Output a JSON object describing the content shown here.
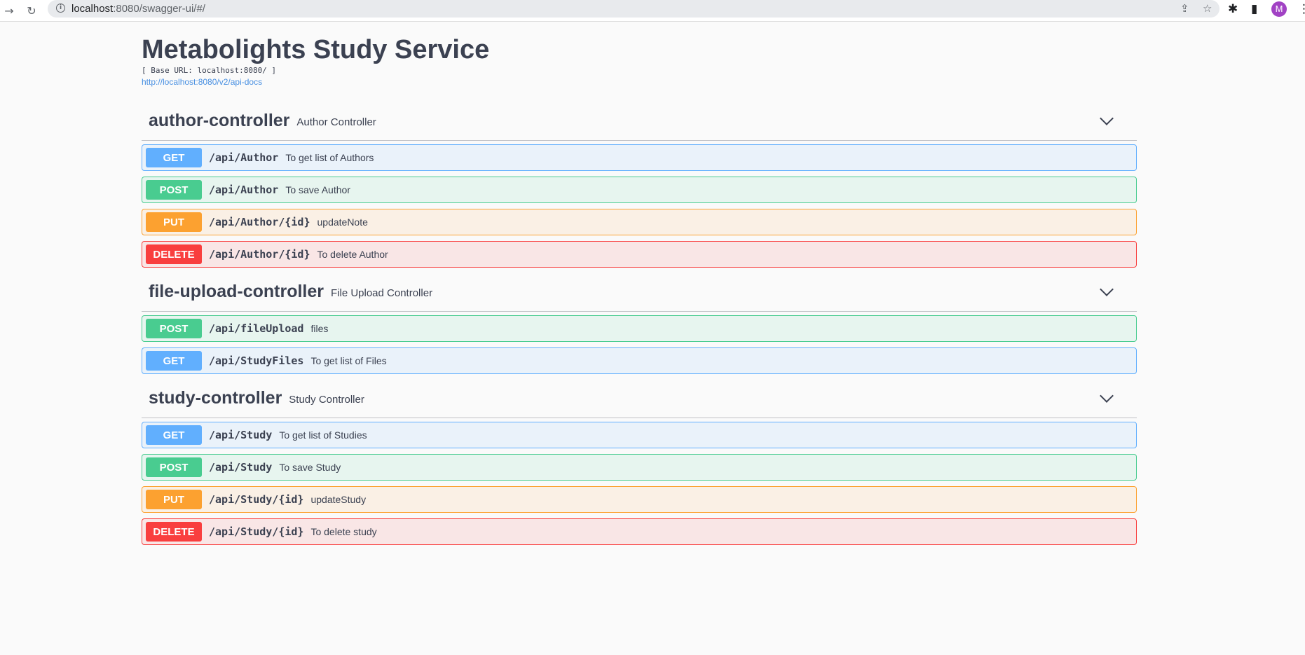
{
  "browser": {
    "url_host": "localhost",
    "url_rest": ":8080/swagger-ui/#/",
    "avatar_letter": "M"
  },
  "info": {
    "title": "Metabolights Study Service",
    "base_url": "[ Base URL: localhost:8080/ ]",
    "spec_link": "http://localhost:8080/v2/api-docs"
  },
  "tags": [
    {
      "name": "author-controller",
      "description": "Author Controller",
      "ops": [
        {
          "method": "GET",
          "path": "/api/Author",
          "summary": "To get list of Authors"
        },
        {
          "method": "POST",
          "path": "/api/Author",
          "summary": "To save Author"
        },
        {
          "method": "PUT",
          "path": "/api/Author/{id}",
          "summary": "updateNote"
        },
        {
          "method": "DELETE",
          "path": "/api/Author/{id}",
          "summary": "To delete Author"
        }
      ]
    },
    {
      "name": "file-upload-controller",
      "description": "File Upload Controller",
      "ops": [
        {
          "method": "POST",
          "path": "/api/fileUpload",
          "summary": "files"
        },
        {
          "method": "GET",
          "path": "/api/StudyFiles",
          "summary": "To get list of Files"
        }
      ]
    },
    {
      "name": "study-controller",
      "description": "Study Controller",
      "ops": [
        {
          "method": "GET",
          "path": "/api/Study",
          "summary": "To get list of Studies"
        },
        {
          "method": "POST",
          "path": "/api/Study",
          "summary": "To save Study"
        },
        {
          "method": "PUT",
          "path": "/api/Study/{id}",
          "summary": "updateStudy"
        },
        {
          "method": "DELETE",
          "path": "/api/Study/{id}",
          "summary": "To delete study"
        }
      ]
    }
  ],
  "colors": {
    "get": "#61affe",
    "post": "#49cc90",
    "put": "#fca130",
    "delete": "#f93e3e",
    "link": "#4990e2"
  },
  "icons": {
    "forward": "arrow-right-icon",
    "reload": "reload-icon",
    "info": "info-icon",
    "share": "share-icon",
    "bookmark": "star-icon",
    "extensions": "puzzle-icon",
    "sidepanel": "side-panel-icon",
    "menu": "kebab-menu-icon",
    "expand": "chevron-down-icon"
  }
}
